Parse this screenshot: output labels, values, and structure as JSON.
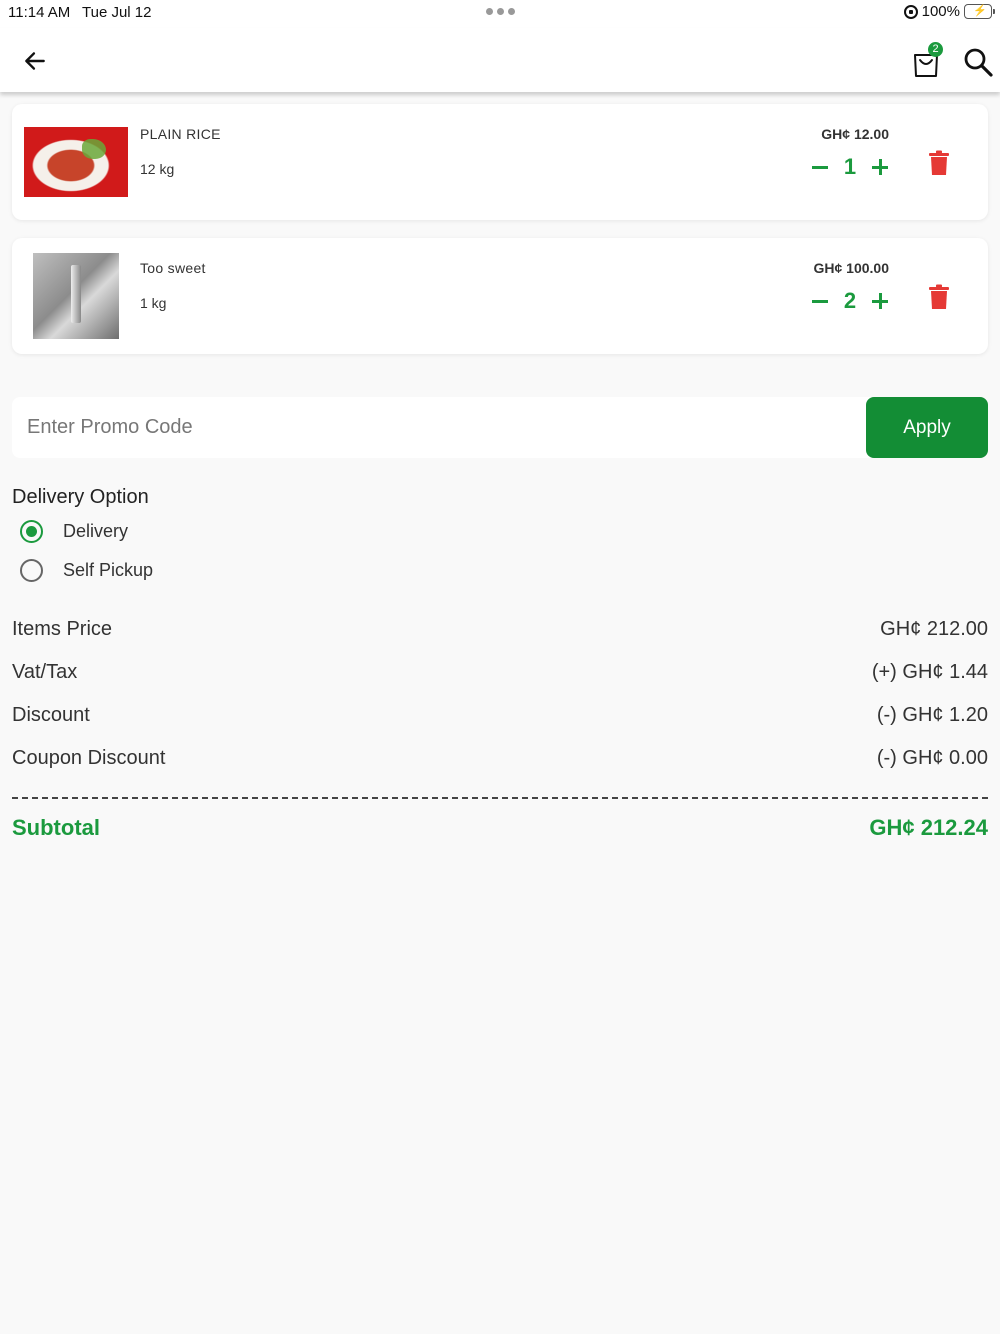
{
  "status_bar": {
    "time": "11:14 AM",
    "date": "Tue Jul 12",
    "battery": "100%"
  },
  "app_bar": {
    "back_icon": "arrow-left-icon",
    "cart_icon": "shopping-bag-icon",
    "cart_count": "2",
    "search_icon": "search-icon"
  },
  "cart": {
    "items": [
      {
        "name": "PLAIN RICE",
        "unit": "12 kg",
        "price": "GH¢ 12.00",
        "quantity": "1",
        "image": "rice-dish-photo"
      },
      {
        "name": "Too sweet",
        "unit": "1 kg",
        "price": "GH¢ 100.00",
        "quantity": "2",
        "image": "faucet-photo"
      }
    ]
  },
  "promo": {
    "placeholder": "Enter Promo Code",
    "apply_label": "Apply"
  },
  "delivery": {
    "title": "Delivery Option",
    "options": [
      {
        "label": "Delivery",
        "selected": true
      },
      {
        "label": "Self Pickup",
        "selected": false
      }
    ]
  },
  "summary": {
    "items_price": {
      "label": "Items Price",
      "value": "GH¢ 212.00"
    },
    "vat_tax": {
      "label": "Vat/Tax",
      "value": "(+) GH¢ 1.44"
    },
    "discount": {
      "label": "Discount",
      "value": "(-) GH¢ 1.20"
    },
    "coupon_discount": {
      "label": "Coupon Discount",
      "value": "(-) GH¢ 0.00"
    },
    "subtotal": {
      "label": "Subtotal",
      "value": "GH¢ 212.24"
    }
  },
  "colors": {
    "accent": "#1b9a3e",
    "apply_button": "#138d35",
    "delete": "#e53935"
  }
}
